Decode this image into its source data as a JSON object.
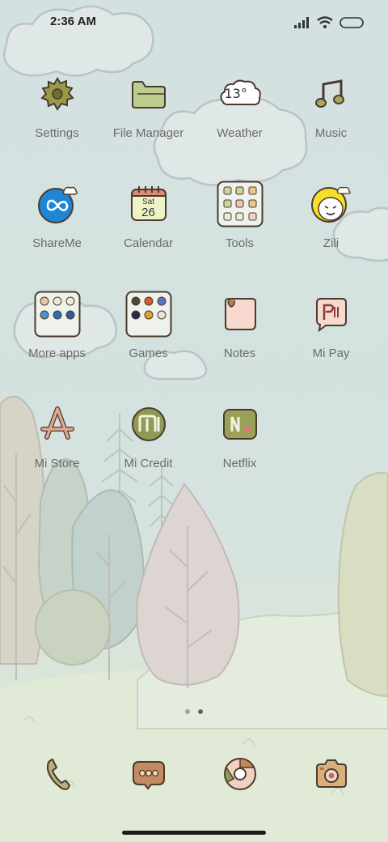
{
  "status": {
    "time": "2:36 AM",
    "icons": [
      "signal-icon",
      "wifi-icon",
      "battery-icon"
    ]
  },
  "apps": [
    {
      "label": "Settings",
      "icon": "gear-icon"
    },
    {
      "label": "File Manager",
      "icon": "folder-icon"
    },
    {
      "label": "Weather",
      "icon": "weather-cloud-icon",
      "temp": "13°"
    },
    {
      "label": "Music",
      "icon": "music-note-icon"
    },
    {
      "label": "ShareMe",
      "icon": "shareme-icon"
    },
    {
      "label": "Calendar",
      "icon": "calendar-icon",
      "day_name": "Sat",
      "day": "26"
    },
    {
      "label": "Tools",
      "icon": "folder-grid-icon"
    },
    {
      "label": "Zili",
      "icon": "zili-face-icon"
    },
    {
      "label": "More apps",
      "icon": "folder-grid-icon"
    },
    {
      "label": "Games",
      "icon": "folder-grid-icon"
    },
    {
      "label": "Notes",
      "icon": "notes-icon"
    },
    {
      "label": "Mi Pay",
      "icon": "mi-pay-icon"
    },
    {
      "label": "Mi Store",
      "icon": "app-store-icon"
    },
    {
      "label": "Mi Credit",
      "icon": "mi-credit-icon"
    },
    {
      "label": "Netflix",
      "icon": "netflix-icon"
    }
  ],
  "pages": {
    "count": 2,
    "active": 2
  },
  "dock": [
    {
      "icon": "phone-icon"
    },
    {
      "icon": "messages-icon"
    },
    {
      "icon": "browser-icon"
    },
    {
      "icon": "camera-icon"
    }
  ],
  "colors": {
    "sky": "#d3e1e0",
    "icon_outline": "#4a3b2c",
    "label": "#6b6b6b"
  }
}
